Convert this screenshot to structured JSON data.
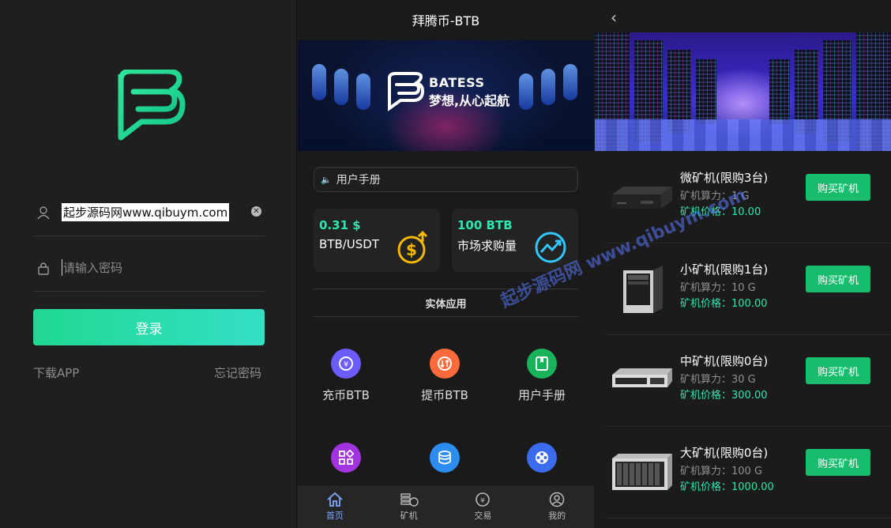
{
  "login": {
    "username_value": "起步源码网www.qibuym.com",
    "password_placeholder": "请输入密码",
    "login_label": "登录",
    "download_label": "下载APP",
    "forgot_label": "忘记密码"
  },
  "home": {
    "title": "拜腾币-BTB",
    "banner": {
      "brand": "BATESS",
      "slogan": "梦想,从心起航"
    },
    "notice": "用户手册",
    "cards": [
      {
        "value": "0.31 $",
        "label": "BTB/USDT",
        "icon": "dollar-coin-icon"
      },
      {
        "value": "100 BTB",
        "label": "市场求购量",
        "icon": "trend-chart-icon"
      }
    ],
    "section_title": "实体应用",
    "apps": [
      {
        "label": "充币BTB",
        "icon": "deposit-icon",
        "color": "#6a5cff"
      },
      {
        "label": "提币BTB",
        "icon": "withdraw-icon",
        "color": "#ff6a3d"
      },
      {
        "label": "用户手册",
        "icon": "manual-icon",
        "color": "#19b45a"
      },
      {
        "label": "",
        "icon": "apps-grid-icon",
        "color": "#a234e0"
      },
      {
        "label": "",
        "icon": "database-icon",
        "color": "#2d8cf0"
      },
      {
        "label": "",
        "icon": "film-reel-icon",
        "color": "#3b6cf0"
      }
    ],
    "tabs": [
      {
        "label": "首页",
        "icon": "home-icon",
        "active": true
      },
      {
        "label": "矿机",
        "icon": "miner-icon",
        "active": false
      },
      {
        "label": "交易",
        "icon": "exchange-icon",
        "active": false
      },
      {
        "label": "我的",
        "icon": "profile-icon",
        "active": false
      }
    ]
  },
  "miners": {
    "power_prefix": "矿机算力：",
    "price_prefix": "矿机价格：",
    "buy_label": "购买矿机",
    "items": [
      {
        "name": "微矿机(限购3台)",
        "power": "矿机算力：1 G",
        "price": "矿机价格：10.00"
      },
      {
        "name": "小矿机(限购1台)",
        "power": "矿机算力：10 G",
        "price": "矿机价格：100.00"
      },
      {
        "name": "中矿机(限购0台)",
        "power": "矿机算力：30 G",
        "price": "矿机价格：300.00"
      },
      {
        "name": "大矿机(限购0台)",
        "power": "矿机算力：100 G",
        "price": "矿机价格：1000.00"
      }
    ]
  },
  "watermark": "起步源码网 www.qibuym.com",
  "colors": {
    "accent": "#2ee6b0",
    "buy": "#17bd6c",
    "active_tab": "#7aa8ff"
  }
}
